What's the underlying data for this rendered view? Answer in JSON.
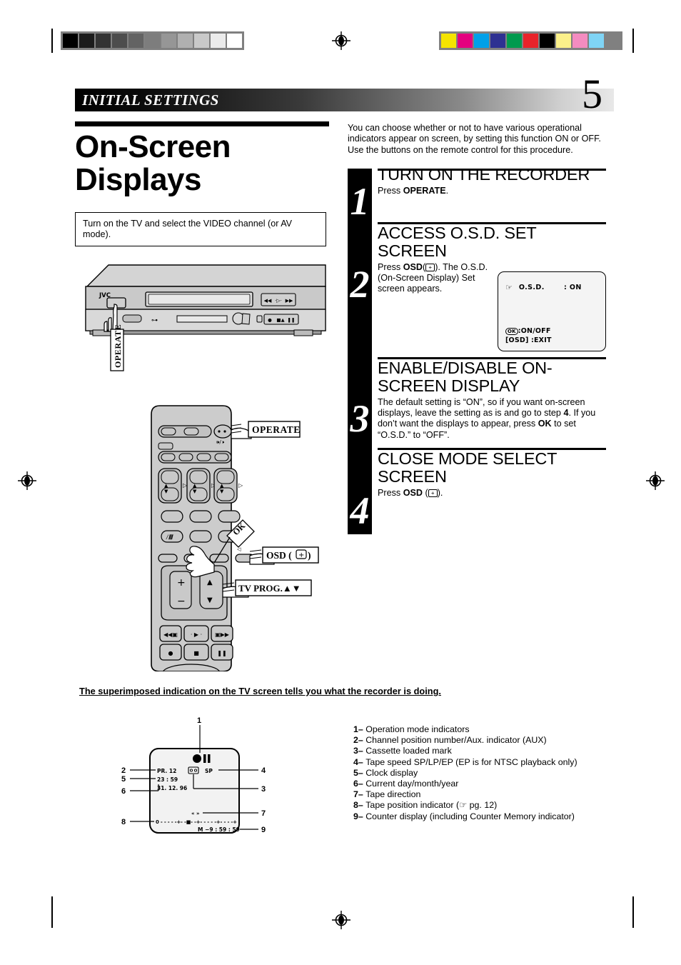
{
  "print_marks": {
    "grayscale_swatches": [
      "#000000",
      "#1c1c1c",
      "#333333",
      "#4d4d4d",
      "#636363",
      "#7d7d7d",
      "#969696",
      "#b0b0b0",
      "#c9c9c9",
      "#ebebeb",
      "#ffffff"
    ],
    "color_swatches": [
      "#f5e400",
      "#e4007f",
      "#00a0e9",
      "#2e3192",
      "#009a4e",
      "#e8232a",
      "#000000",
      "#fbf08a",
      "#f48cc0",
      "#7fd4f5",
      "#808080"
    ],
    "registration_icon": "registration-target-icon"
  },
  "header": {
    "chapter": "INITIAL SETTINGS",
    "page_number": "5"
  },
  "left": {
    "title": "On-Screen Displays",
    "tv_note": "Turn on the TV and select the VIDEO channel (or AV mode).",
    "vcr_brand": "JVC",
    "vcr_callout": "OPERATE"
  },
  "intro": "You can choose whether or not to have various operational indicators appear on screen, by setting this function ON or OFF. Use the buttons on the remote control for this procedure.",
  "steps": [
    {
      "number": "1",
      "heading": "TURN ON THE RECORDER",
      "body_pre": "Press ",
      "body_bold": "OPERATE",
      "body_post": "."
    },
    {
      "number": "2",
      "heading": "ACCESS O.S.D. SET SCREEN",
      "body_pre": "Press ",
      "body_bold": "OSD",
      "body_post": "( ). The O.S.D. (On-Screen Display) Set screen appears."
    },
    {
      "number": "3",
      "heading": "ENABLE/DISABLE ON-SCREEN DISPLAY",
      "body_pre": "The default setting is “ON”, so if you want on-screen displays, leave the setting as is and go to step ",
      "body_bold": "4",
      "body_post": ". If you don’t want the displays to appear, press ",
      "body_bold2": "OK",
      "body_post2": " to set “O.S.D.” to “OFF”."
    },
    {
      "number": "4",
      "heading": "CLOSE MODE SELECT SCREEN",
      "body_pre": "Press ",
      "body_bold": "OSD",
      "body_post": " ( )."
    }
  ],
  "osd_screen": {
    "pointer_icon": "pointing-hand-icon",
    "label": "O.S.D.",
    "value": ": ON",
    "footer_line1_key": "OK",
    "footer_line1": ":ON/OFF",
    "footer_line2": "[OSD]  :EXIT"
  },
  "remote": {
    "callouts": [
      {
        "label": "OPERATE"
      },
      {
        "label": "OSD (⊕)"
      },
      {
        "label": "TV PROG.▲▼"
      }
    ],
    "ok_label": "OK",
    "speaker_label": "⏷/⏸"
  },
  "bottom": {
    "note": "The superimposed indication on the TV screen tells you what the recorder is doing.",
    "screen": {
      "channel": "PR.  12",
      "clock": "23 : 59",
      "date": "31.  12. 96",
      "speed": "SP",
      "cassette_icon": "cassette-loaded-icon",
      "mode_icons": "record-pause-icon",
      "direction": "« »",
      "position_bar": "0 - - - - - + - -■- - + - - - - - + - - - - +",
      "counter": "M –9 : 59 : 59"
    },
    "callout_numbers": [
      "1",
      "2",
      "3",
      "4",
      "5",
      "6",
      "7",
      "8",
      "9"
    ],
    "legend": [
      {
        "n": "1–",
        "text": "Operation mode indicators"
      },
      {
        "n": "2–",
        "text": "Channel position number/Aux. indicator (AUX)"
      },
      {
        "n": "3–",
        "text": "Cassette loaded mark"
      },
      {
        "n": "4–",
        "text": "Tape speed SP/LP/EP (EP is for NTSC playback only)"
      },
      {
        "n": "5–",
        "text": "Clock display"
      },
      {
        "n": "6–",
        "text": "Current day/month/year"
      },
      {
        "n": "7–",
        "text": "Tape direction"
      },
      {
        "n": "8–",
        "text": "Tape position indicator (☞ pg. 12)"
      },
      {
        "n": "9–",
        "text": "Counter display (including Counter Memory indicator)"
      }
    ]
  }
}
